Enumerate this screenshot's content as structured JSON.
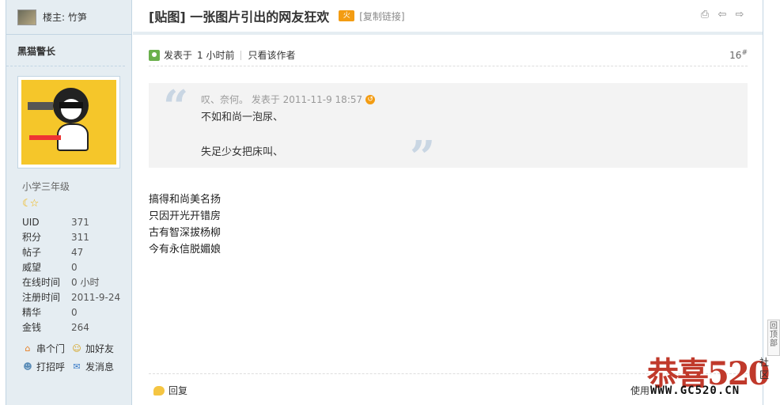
{
  "host": {
    "label": "楼主: 竹笋"
  },
  "author": {
    "name": "黑猫警长",
    "rank": "小学三年级",
    "stars": "☾☆",
    "stats": [
      {
        "k": "UID",
        "v": "371"
      },
      {
        "k": "积分",
        "v": "311"
      },
      {
        "k": "帖子",
        "v": "47"
      },
      {
        "k": "威望",
        "v": "0"
      },
      {
        "k": "在线时间",
        "v": "0 小时"
      },
      {
        "k": "注册时间",
        "v": "2011-9-24"
      },
      {
        "k": "精华",
        "v": "0"
      },
      {
        "k": "金钱",
        "v": "264"
      }
    ],
    "actions": {
      "visit": "串个门",
      "add_friend": "加好友",
      "poke": "打招呼",
      "message": "发消息"
    }
  },
  "thread": {
    "title": "[贴图] 一张图片引出的网友狂欢",
    "hot_badge": "火",
    "copy_link": "[复制链接]",
    "icons": [
      "print-icon",
      "prev-thread-icon",
      "next-thread-icon"
    ]
  },
  "post": {
    "posted": "发表于",
    "time": "1 小时前",
    "only_author": "只看该作者",
    "floor": "16",
    "floor_mark": "#",
    "quote": {
      "open_mark": "“",
      "close_mark": "”",
      "head": "叹、奈何。 发表于 2011-11-9 18:57",
      "back": "↺",
      "line1": "不如和尚一泡尿、",
      "line2": "失足少女把床叫、"
    },
    "lines": [
      "搞得和尚美名扬",
      "只因开光开错房",
      "古有智深拔杨柳",
      "今有永信脱媚娘"
    ],
    "reply": "回复",
    "use": "使用"
  },
  "watermark": {
    "brand": "恭喜520",
    "she": "社区",
    "url": "WWW.GC520.CN"
  },
  "back_to_top": "回顶部"
}
